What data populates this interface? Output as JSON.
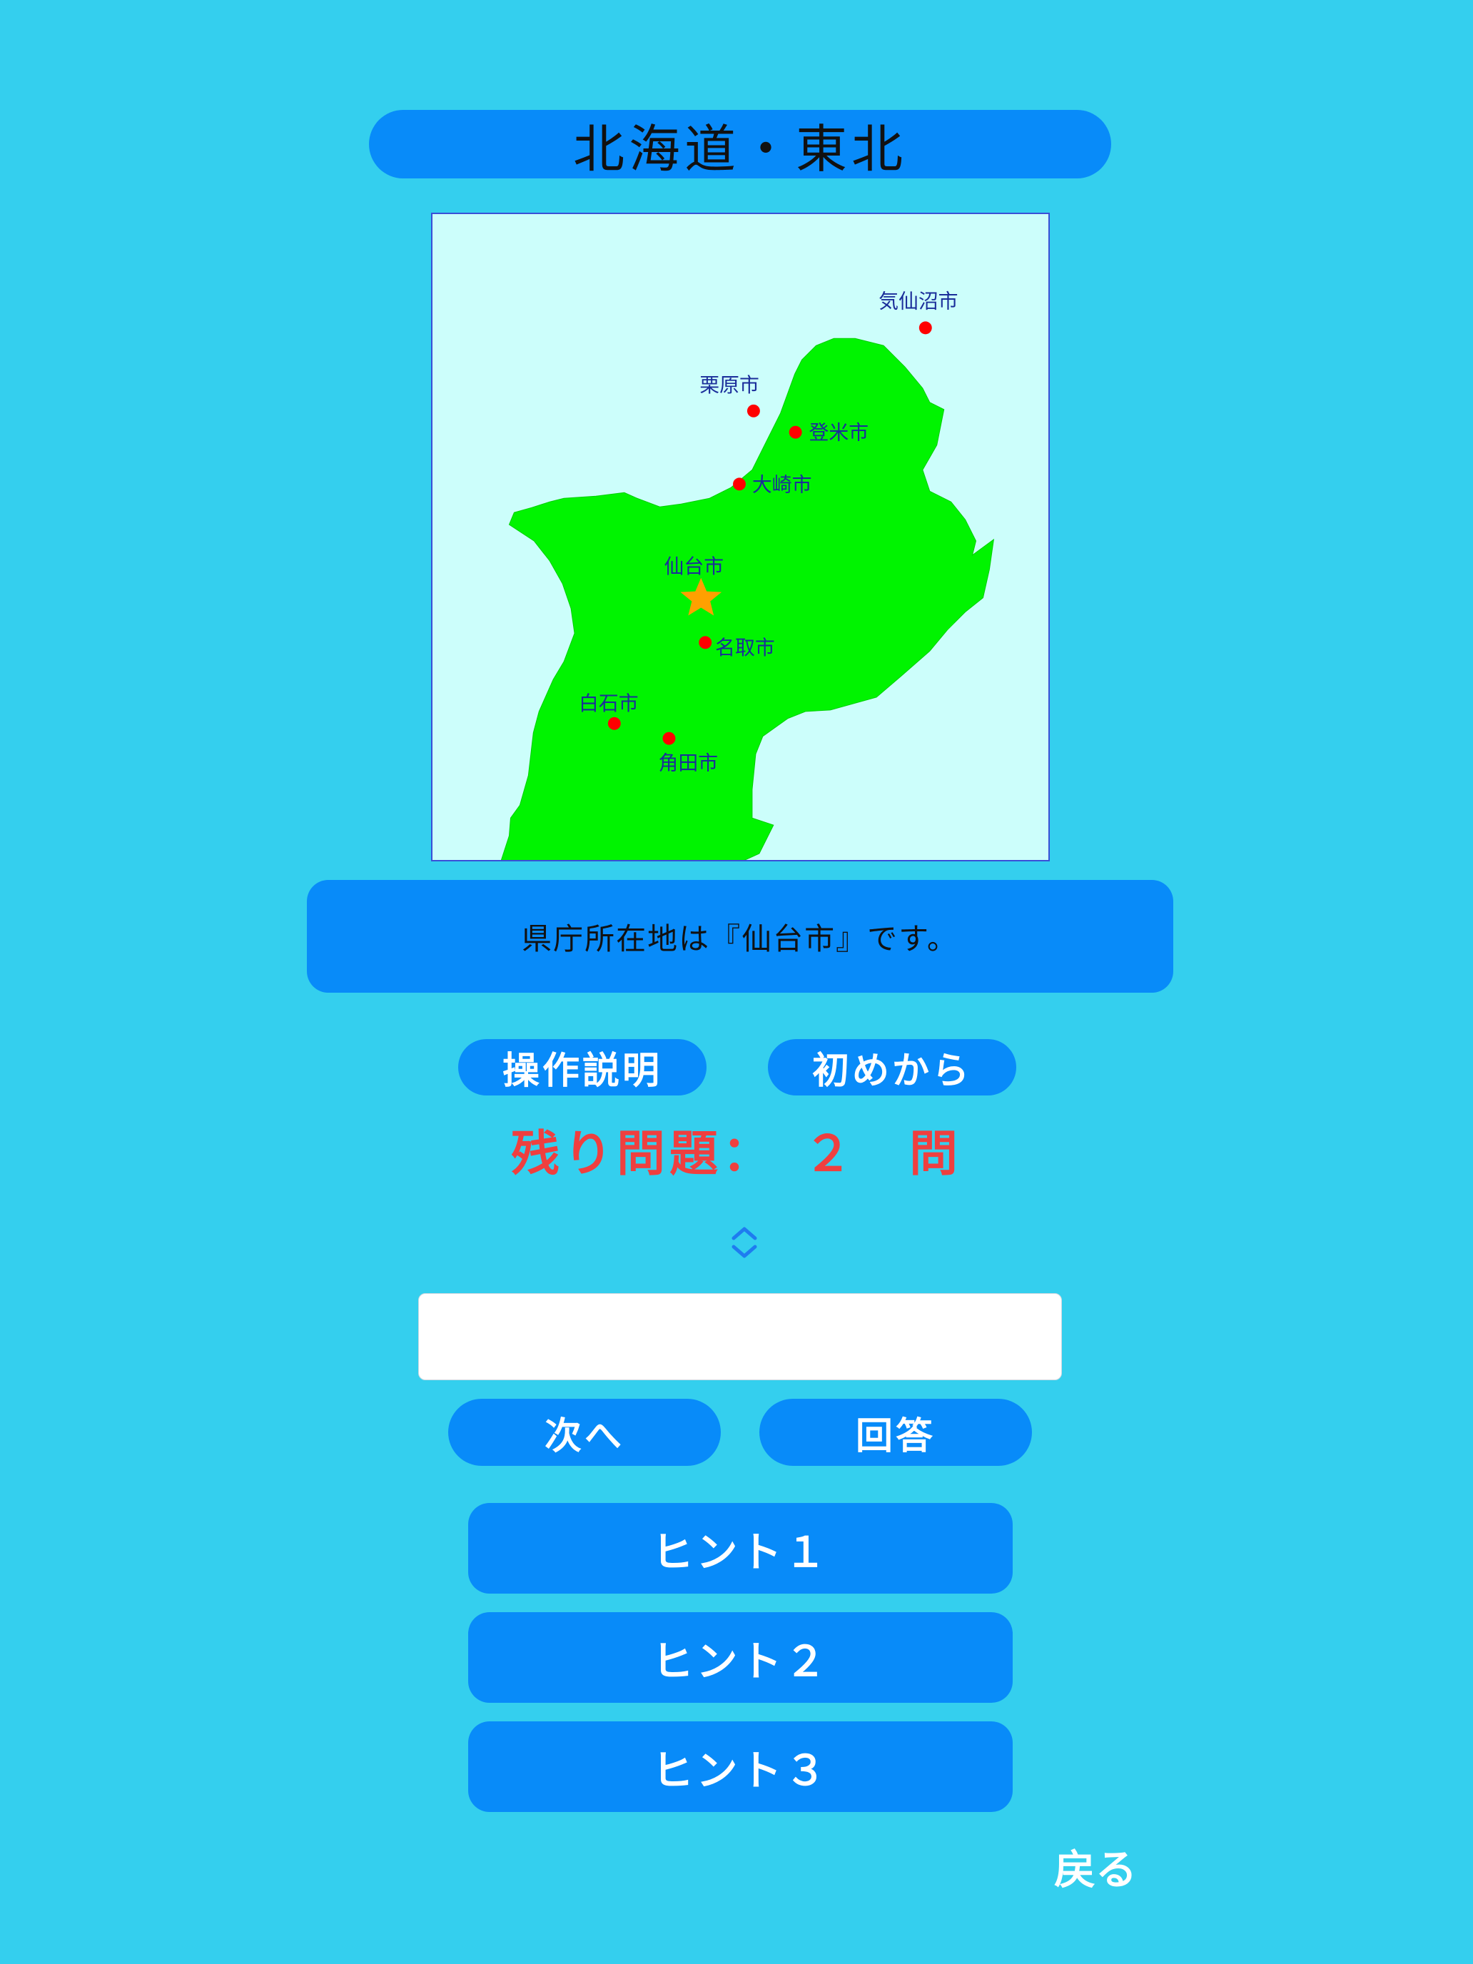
{
  "header": {
    "title": "北海道・東北"
  },
  "map": {
    "colors": {
      "sea": "#ccfefb",
      "land": "#00f400",
      "city_dot": "#ff0000",
      "capital_star": "#ffa000"
    },
    "cities": [
      {
        "name": "気仙沼市"
      },
      {
        "name": "栗原市"
      },
      {
        "name": "登米市"
      },
      {
        "name": "大崎市"
      },
      {
        "name": "仙台市",
        "capital": true
      },
      {
        "name": "名取市"
      },
      {
        "name": "白石市"
      },
      {
        "name": "角田市"
      }
    ]
  },
  "message": {
    "text": "県庁所在地は『仙台市』です。"
  },
  "controls": {
    "help_label": "操作説明",
    "restart_label": "初めから"
  },
  "status": {
    "remaining": "残り問題：　２　問"
  },
  "answer": {
    "value": "",
    "placeholder": ""
  },
  "actions": {
    "next_label": "次へ",
    "answer_label": "回答"
  },
  "hints": [
    "ヒント１",
    "ヒント２",
    "ヒント３"
  ],
  "footer": {
    "back_label": "戻る"
  },
  "theme": {
    "background": "#34cfee",
    "button": "#088bf9",
    "remaining_text": "#ef3f3f"
  }
}
